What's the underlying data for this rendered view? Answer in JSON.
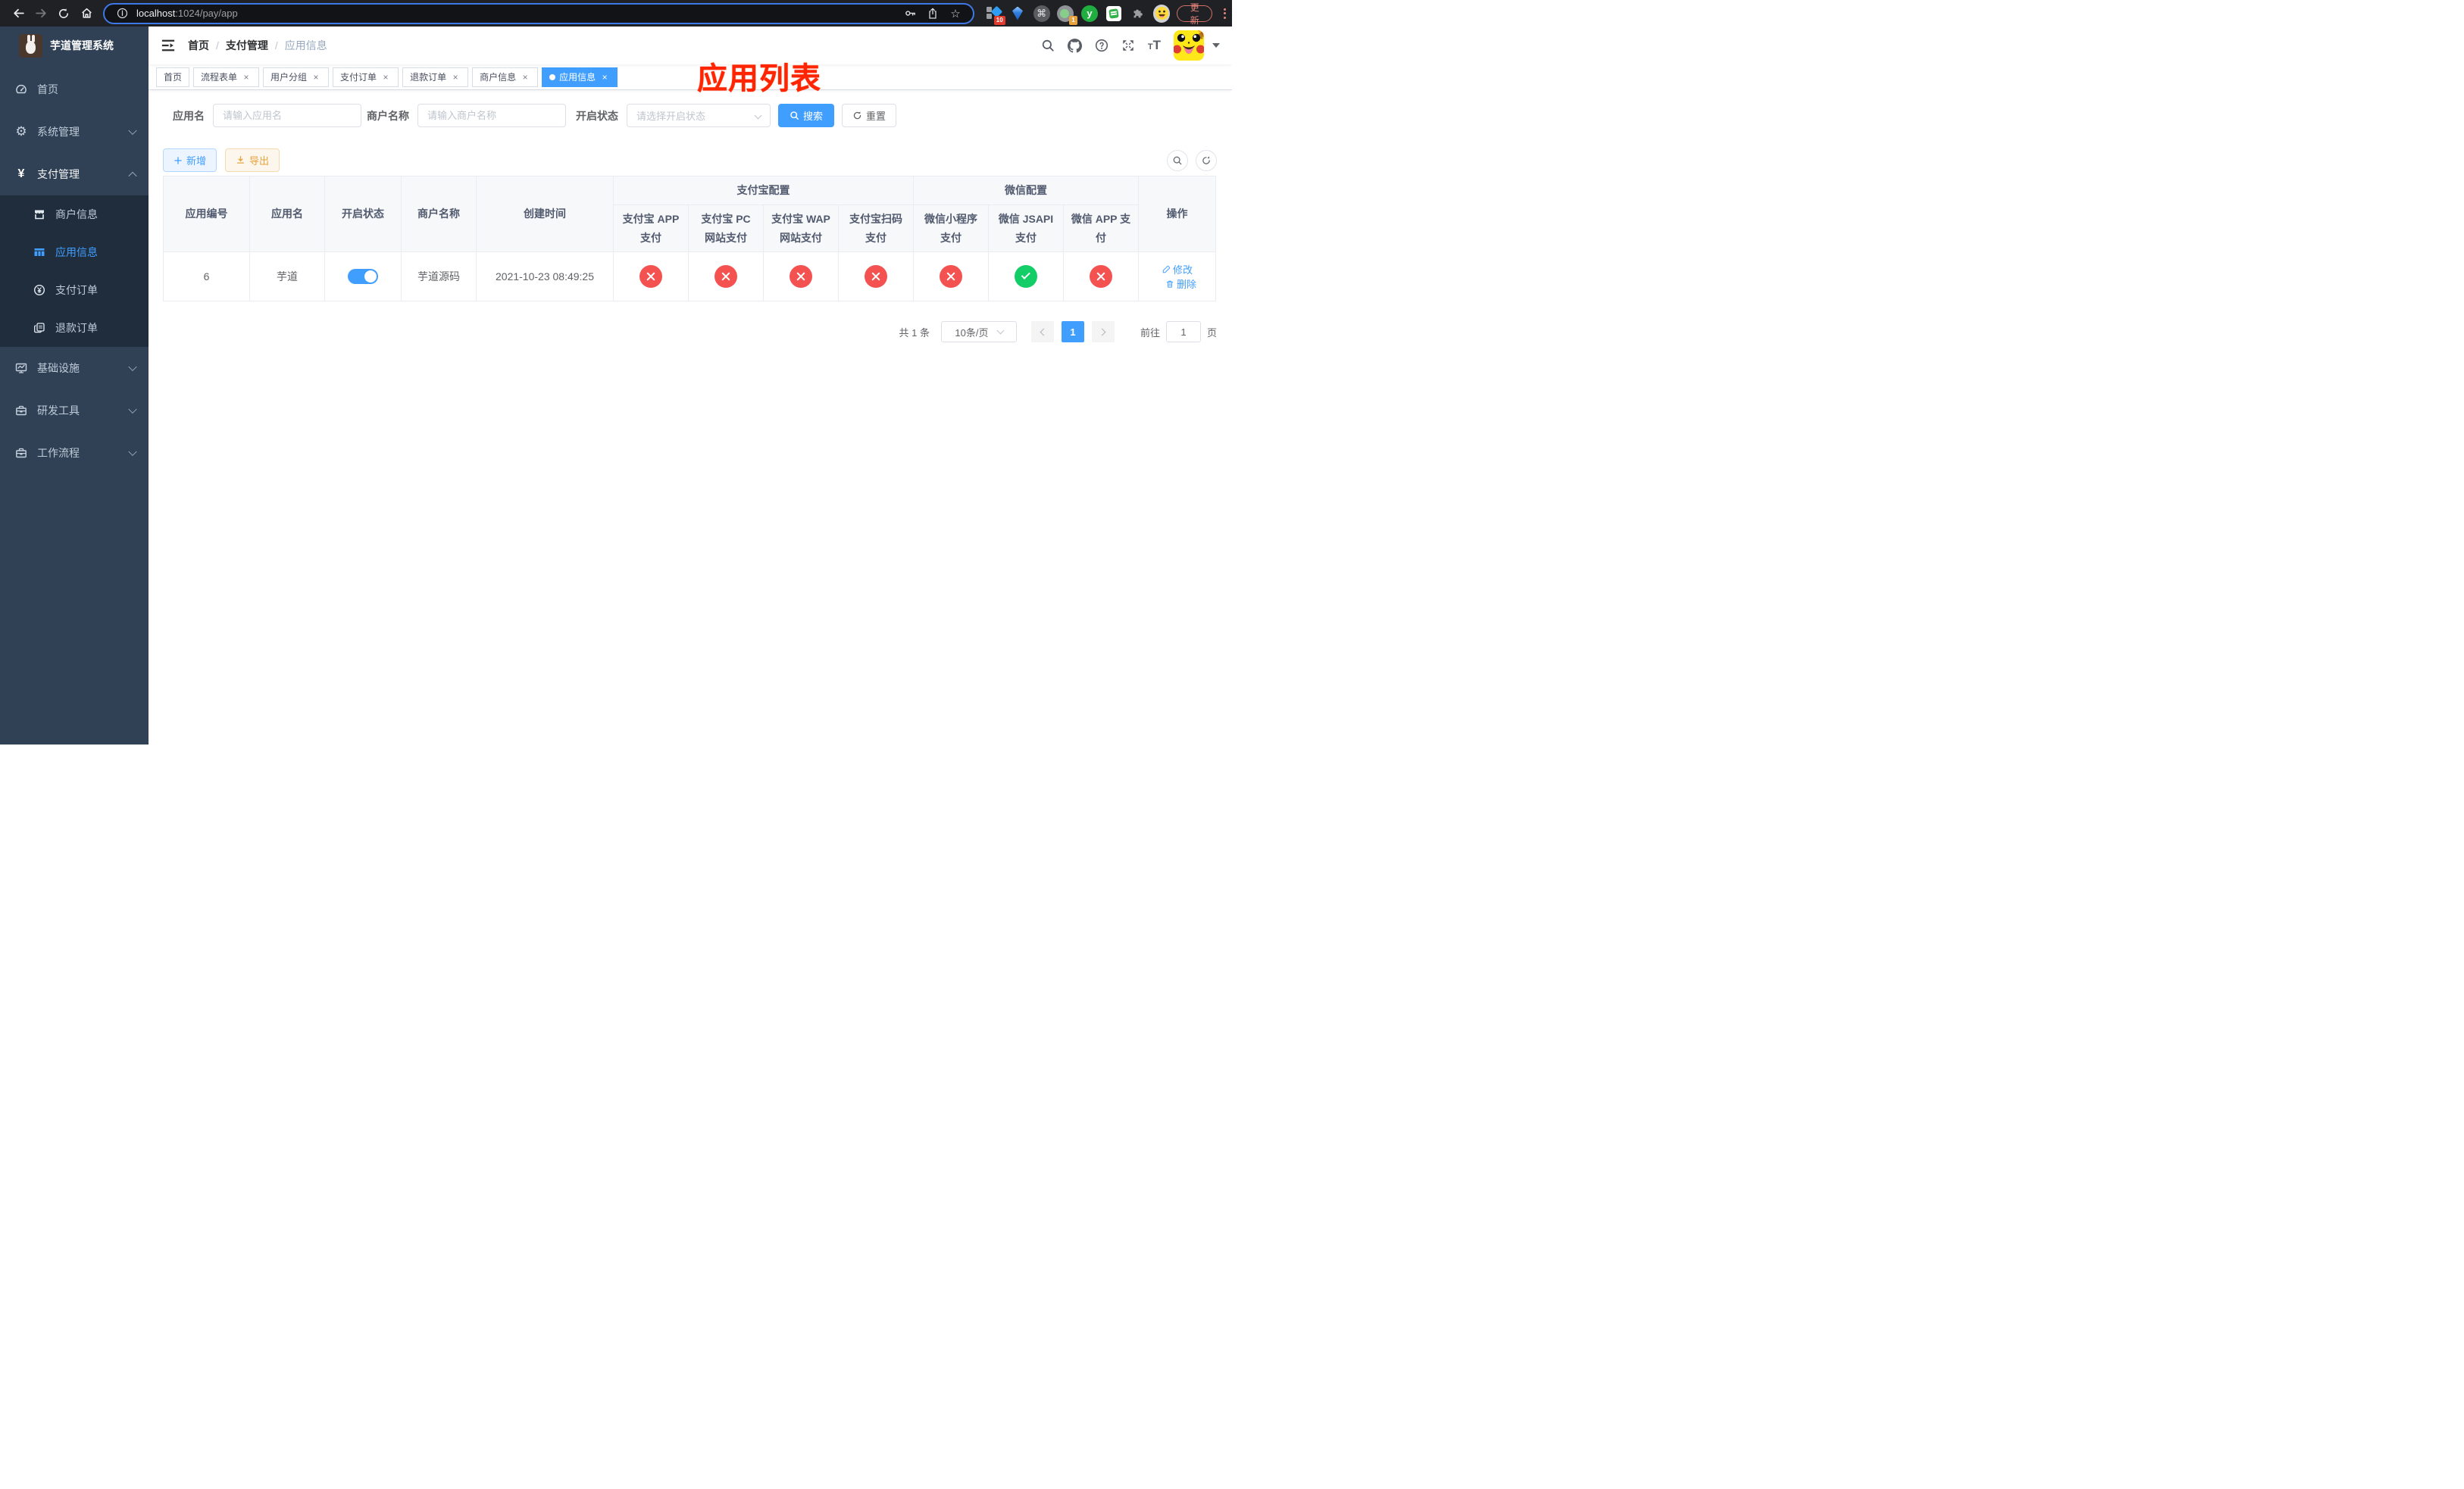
{
  "browser": {
    "url_host": "localhost",
    "url_rest": ":1024/pay/app",
    "update_label": "更新",
    "ext_badge_blue": "10",
    "ext_badge_green": "1"
  },
  "sidebar": {
    "title": "芋道管理系统",
    "items": {
      "home": "首页",
      "system": "系统管理",
      "pay": "支付管理",
      "merchant": "商户信息",
      "app": "应用信息",
      "pay_order": "支付订单",
      "refund_order": "退款订单",
      "infra": "基础设施",
      "dev_tools": "研发工具",
      "workflow": "工作流程"
    }
  },
  "breadcrumb": {
    "home": "首页",
    "section": "支付管理",
    "current": "应用信息",
    "separator": "/"
  },
  "overlay_title": "应用列表",
  "tabs": [
    {
      "label": "首页"
    },
    {
      "label": "流程表单"
    },
    {
      "label": "用户分组"
    },
    {
      "label": "支付订单"
    },
    {
      "label": "退款订单"
    },
    {
      "label": "商户信息"
    },
    {
      "label": "应用信息"
    }
  ],
  "filters": {
    "app_name_label": "应用名",
    "app_name_placeholder": "请输入应用名",
    "merchant_label": "商户名称",
    "merchant_placeholder": "请输入商户名称",
    "status_label": "开启状态",
    "status_placeholder": "请选择开启状态",
    "search_label": "搜索",
    "reset_label": "重置"
  },
  "toolbar": {
    "add_label": "新增",
    "export_label": "导出"
  },
  "table": {
    "group_alipay": "支付宝配置",
    "group_wechat": "微信配置",
    "col_app_id": "应用编号",
    "col_app_name": "应用名",
    "col_status": "开启状态",
    "col_merchant": "商户名称",
    "col_created": "创建时间",
    "col_alipay_app": "支付宝 APP 支付",
    "col_alipay_pc": "支付宝 PC 网站支付",
    "col_alipay_wap": "支付宝 WAP 网站支付",
    "col_alipay_qr": "支付宝扫码支付",
    "col_wx_lite": "微信小程序支付",
    "col_wx_jsapi": "微信 JSAPI 支付",
    "col_wx_app": "微信 APP 支付",
    "col_actions": "操作",
    "row": {
      "id": "6",
      "name": "芋道",
      "enabled": true,
      "merchant": "芋道源码",
      "created": "2021-10-23 08:49:25",
      "alipay_app": "disabled",
      "alipay_pc": "disabled",
      "alipay_wap": "disabled",
      "alipay_qr": "disabled",
      "wx_lite": "disabled",
      "wx_jsapi": "enabled",
      "wx_app": "disabled",
      "edit_label": "修改",
      "delete_label": "删除"
    }
  },
  "pagination": {
    "total": "共 1 条",
    "page_size": "10条/页",
    "current_page": "1",
    "goto_label": "前往",
    "goto_value": "1",
    "page_unit": "页"
  },
  "colors": {
    "accent": "#409eff",
    "success": "#13ce66",
    "danger": "#f45151",
    "warning": "#e6a23c",
    "sidebar_bg": "#304156",
    "submenu_bg": "#1f2d3d",
    "overlay_red": "#fe2500"
  }
}
